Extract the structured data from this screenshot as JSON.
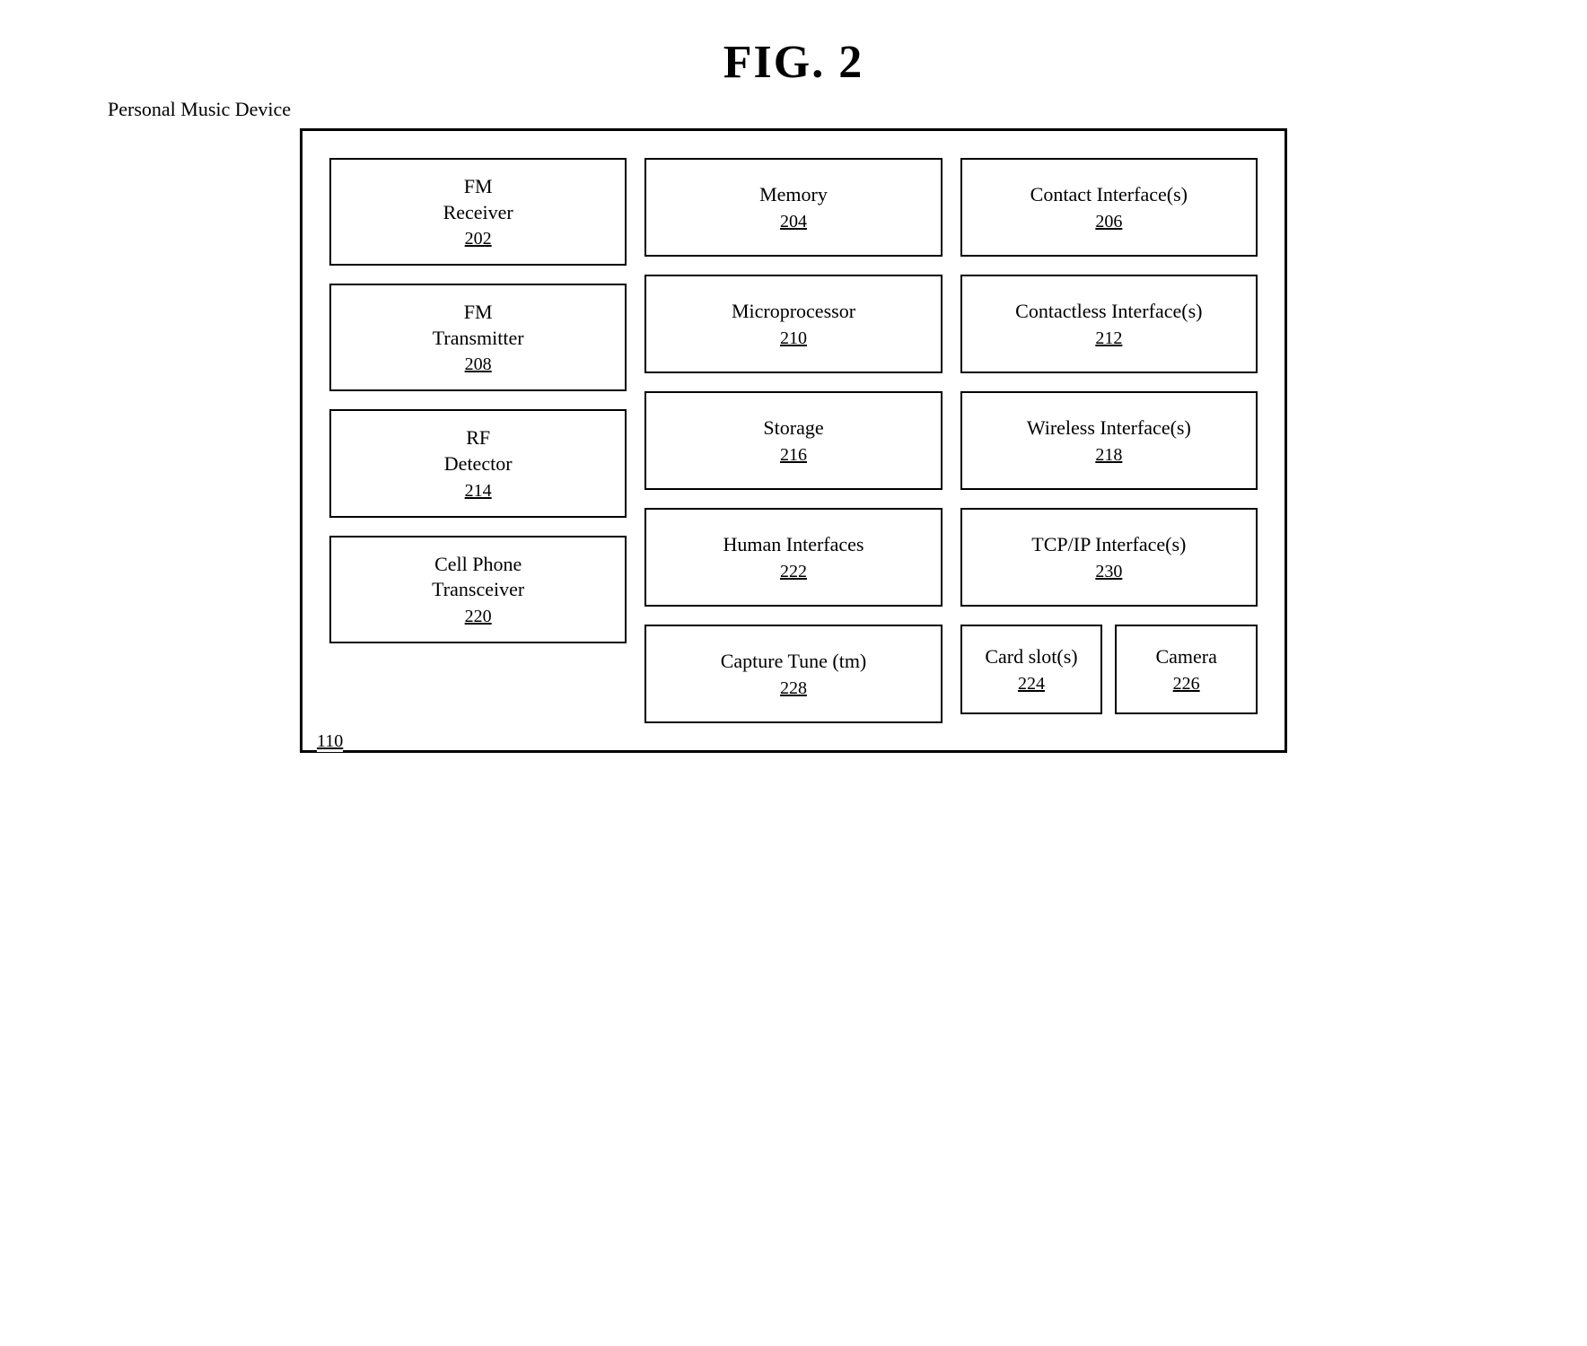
{
  "page": {
    "title": "FIG. 2",
    "device_label": "Personal Music Device",
    "outer_box_id": "110"
  },
  "col1": {
    "items": [
      {
        "name": "FM\nReceiver",
        "id": "202"
      },
      {
        "name": "FM\nTransmitter",
        "id": "208"
      },
      {
        "name": "RF\nDetector",
        "id": "214"
      },
      {
        "name": "Cell Phone\nTransceiver",
        "id": "220"
      }
    ]
  },
  "col2": {
    "items": [
      {
        "name": "Memory",
        "id": "204"
      },
      {
        "name": "Microprocessor",
        "id": "210"
      },
      {
        "name": "Storage",
        "id": "216"
      },
      {
        "name": "Human Interfaces",
        "id": "222"
      },
      {
        "name": "Capture Tune (tm)",
        "id": "228"
      }
    ]
  },
  "col3": {
    "items_top": [
      {
        "name": "Contact Interface(s)",
        "id": "206"
      },
      {
        "name": "Contactless Interface(s)",
        "id": "212"
      },
      {
        "name": "Wireless Interface(s)",
        "id": "218"
      },
      {
        "name": "TCP/IP  Interface(s)",
        "id": "230"
      }
    ],
    "items_bottom": [
      {
        "name": "Card slot(s)",
        "id": "224"
      },
      {
        "name": "Camera",
        "id": "226"
      }
    ]
  }
}
